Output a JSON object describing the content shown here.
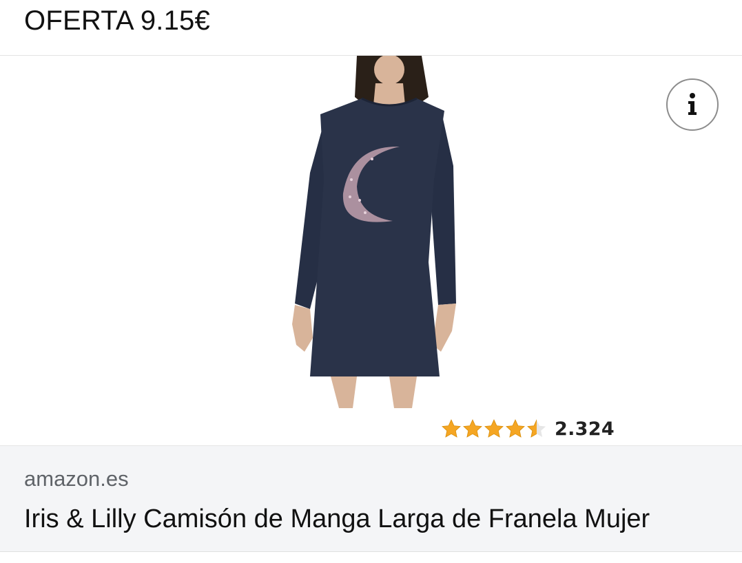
{
  "header": {
    "offer_text": "OFERTA 9.15€"
  },
  "product_image": {
    "description_icon": "product-photo-nightgown"
  },
  "info_button": {
    "icon": "info-icon",
    "glyph": "i"
  },
  "rating": {
    "stars": 4.5,
    "max_stars": 5,
    "count": "2.324",
    "star_color": "#f5a623"
  },
  "footer": {
    "domain": "amazon.es",
    "title": "Iris & Lilly Camisón de Manga Larga de Franela Mujer"
  }
}
